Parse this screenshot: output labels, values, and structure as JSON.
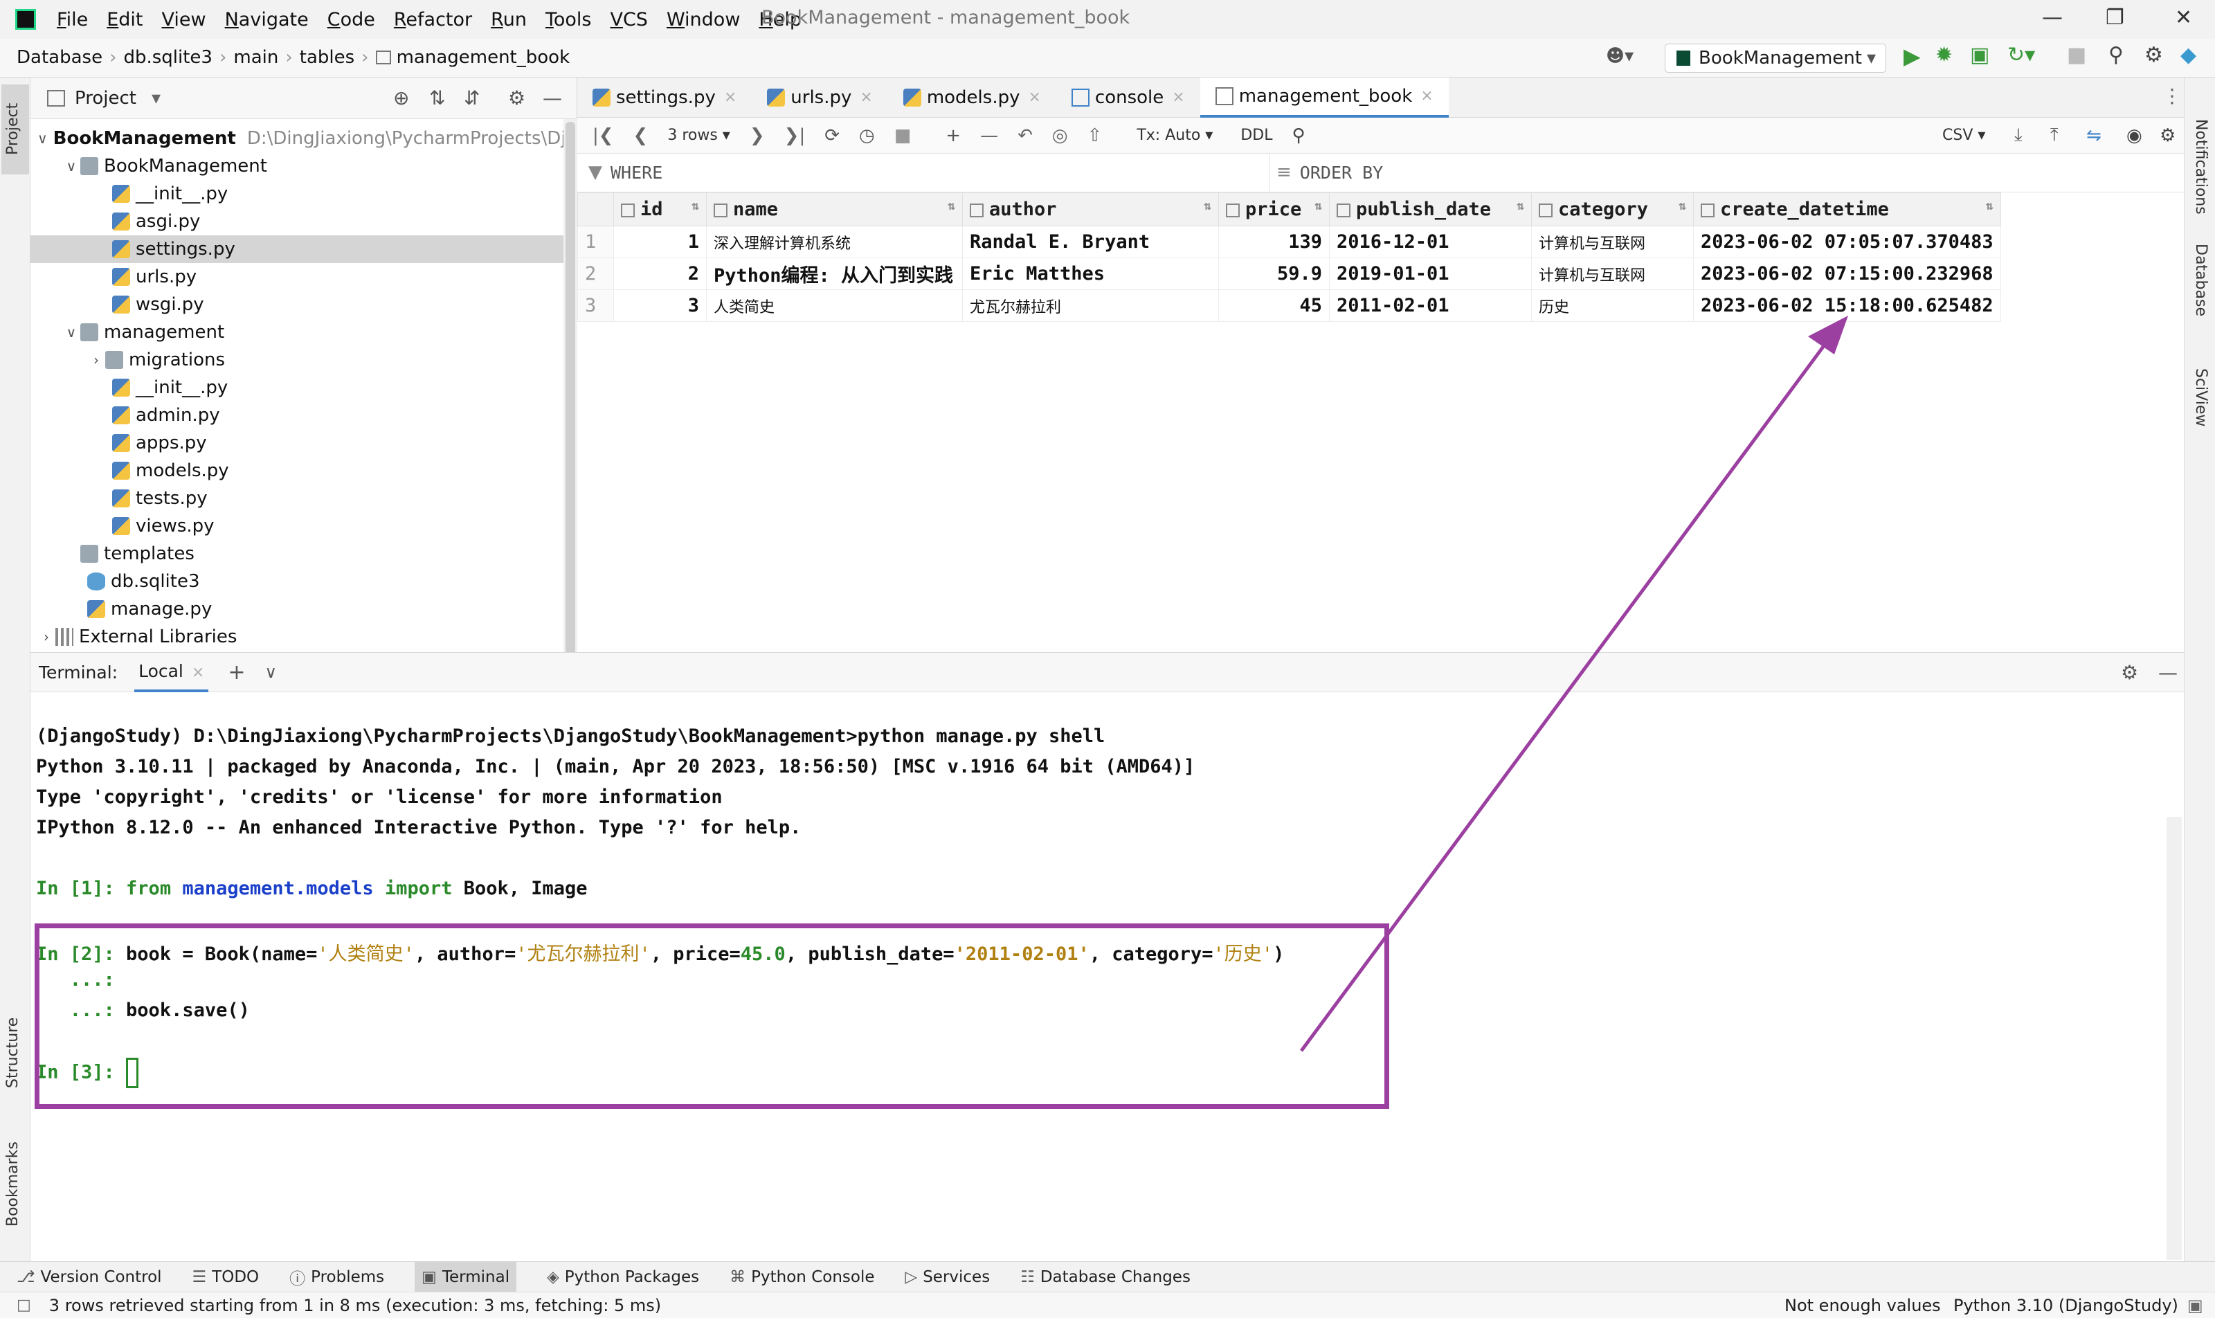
{
  "menubar": {
    "items": [
      "File",
      "Edit",
      "View",
      "Navigate",
      "Code",
      "Refactor",
      "Run",
      "Tools",
      "VCS",
      "Window",
      "Help"
    ],
    "title": "BookManagement - management_book"
  },
  "navbar": {
    "crumbs": [
      "Database",
      "db.sqlite3",
      "main",
      "tables",
      "management_book"
    ],
    "run_config": "BookManagement"
  },
  "left_stripe": {
    "project": "Project",
    "structure": "Structure",
    "bookmarks": "Bookmarks"
  },
  "right_stripe": {
    "notifications": "Notifications",
    "database": "Database",
    "sciview": "SciView"
  },
  "project": {
    "title": "Project",
    "root": {
      "name": "BookManagement",
      "path": "D:\\DingJiaxiong\\PycharmProjects\\Djangc"
    },
    "items": [
      {
        "label": "BookManagement",
        "depth": 1,
        "type": "folder",
        "expanded": true
      },
      {
        "label": "__init__.py",
        "depth": 2,
        "type": "py"
      },
      {
        "label": "asgi.py",
        "depth": 2,
        "type": "py"
      },
      {
        "label": "settings.py",
        "depth": 2,
        "type": "py",
        "selected": true
      },
      {
        "label": "urls.py",
        "depth": 2,
        "type": "py"
      },
      {
        "label": "wsgi.py",
        "depth": 2,
        "type": "py"
      },
      {
        "label": "management",
        "depth": 1,
        "type": "folder",
        "expanded": true
      },
      {
        "label": "migrations",
        "depth": 2,
        "type": "folder",
        "expanded": false
      },
      {
        "label": "__init__.py",
        "depth": 2,
        "type": "py"
      },
      {
        "label": "admin.py",
        "depth": 2,
        "type": "py"
      },
      {
        "label": "apps.py",
        "depth": 2,
        "type": "py"
      },
      {
        "label": "models.py",
        "depth": 2,
        "type": "py"
      },
      {
        "label": "tests.py",
        "depth": 2,
        "type": "py"
      },
      {
        "label": "views.py",
        "depth": 2,
        "type": "py"
      },
      {
        "label": "templates",
        "depth": 1,
        "type": "folder"
      },
      {
        "label": "db.sqlite3",
        "depth": 1,
        "type": "db"
      },
      {
        "label": "manage.py",
        "depth": 1,
        "type": "py"
      },
      {
        "label": "External Libraries",
        "depth": 0,
        "type": "lib",
        "expanded": false
      }
    ]
  },
  "editor_tabs": [
    {
      "label": "settings.py",
      "active": false
    },
    {
      "label": "urls.py",
      "active": false
    },
    {
      "label": "models.py",
      "active": false
    },
    {
      "label": "console",
      "active": false
    },
    {
      "label": "management_book",
      "active": true
    }
  ],
  "db_toolbar": {
    "rows": "3 rows",
    "tx": "Tx: Auto",
    "ddl": "DDL",
    "export": "CSV"
  },
  "filter": {
    "where": "WHERE",
    "order_by": "ORDER BY"
  },
  "table": {
    "columns": [
      "id",
      "name",
      "author",
      "price",
      "publish_date",
      "category",
      "create_datetime"
    ],
    "rows": [
      {
        "rn": "1",
        "id": "1",
        "name": "深入理解计算机系统",
        "author": "Randal E. Bryant",
        "price": "139",
        "publish_date": "2016-12-01",
        "category": "计算机与互联网",
        "create_datetime": "2023-06-02 07:05:07.370483"
      },
      {
        "rn": "2",
        "id": "2",
        "name": "Python编程: 从入门到实践",
        "author": "Eric Matthes",
        "price": "59.9",
        "publish_date": "2019-01-01",
        "category": "计算机与互联网",
        "create_datetime": "2023-06-02 07:15:00.232968"
      },
      {
        "rn": "3",
        "id": "3",
        "name": "人类简史",
        "author": "尤瓦尔赫拉利",
        "price": "45",
        "publish_date": "2011-02-01",
        "category": "历史",
        "create_datetime": "2023-06-02 15:18:00.625482"
      }
    ]
  },
  "terminal": {
    "label": "Terminal:",
    "tab": "Local",
    "lines": {
      "l1": "(DjangoStudy) D:\\DingJiaxiong\\PycharmProjects\\DjangoStudy\\BookManagement>python manage.py shell",
      "l2": "Python 3.10.11 | packaged by Anaconda, Inc. | (main, Apr 20 2023, 18:56:50) [MSC v.1916 64 bit (AMD64)]",
      "l3": "Type 'copyright', 'credits' or 'license' for more information",
      "l4": "IPython 8.12.0 -- An enhanced Interactive Python. Type '?' for help."
    },
    "in1": {
      "prompt": "In [1]: ",
      "from": "from ",
      "module": "management.models",
      "import": " import ",
      "names": "Book, Image"
    },
    "in2": {
      "prompt": "In [2]: ",
      "code_a": "book = Book(name=",
      "s_name": "'人类简史'",
      "code_b": ", author=",
      "s_author": "'尤瓦尔赫拉利'",
      "code_c": ", price=",
      "price": "45.0",
      "code_d": ", publish_date=",
      "s_date": "'2011-02-01'",
      "code_e": ", category=",
      "s_cat": "'历史'",
      "code_f": ")"
    },
    "cont1": "   ...: ",
    "cont2": "   ...: ",
    "save": "book.save()",
    "in3": {
      "prompt": "In [3]: "
    }
  },
  "bottom_tabs": [
    "Version Control",
    "TODO",
    "Problems",
    "Terminal",
    "Python Packages",
    "Python Console",
    "Services",
    "Database Changes"
  ],
  "status": {
    "left": "3 rows retrieved starting from 1 in 8 ms (execution: 3 ms, fetching: 5 ms)",
    "middle": "Not enough values",
    "right": "Python 3.10 (DjangoStudy)"
  },
  "colors": {
    "highlight": "#9b3fa0",
    "accent": "#4083c9",
    "prompt_green": "#2a8a2a"
  }
}
